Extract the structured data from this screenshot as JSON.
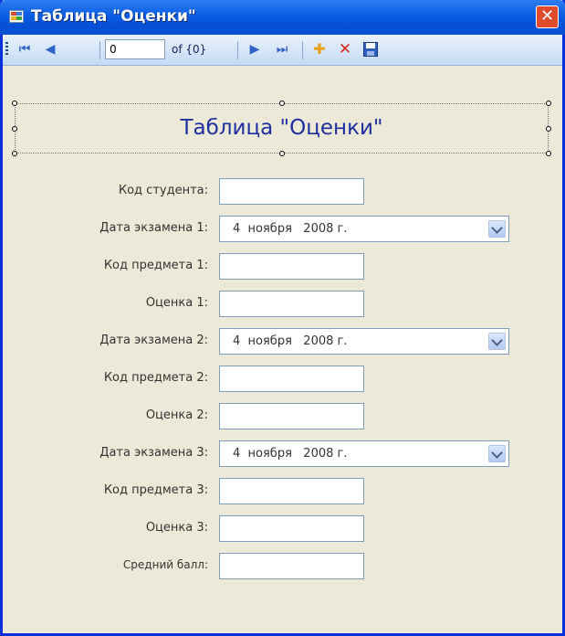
{
  "window": {
    "title": "Таблица \"Оценки\"",
    "close_glyph": "✕"
  },
  "toolbar": {
    "move_first": "⏮",
    "move_prev": "◀",
    "position_value": "0",
    "count_label": "of {0}",
    "move_next": "▶",
    "move_last": "⏭",
    "add_glyph": "✚",
    "delete_glyph": "✕",
    "save_glyph": "💾"
  },
  "form": {
    "header": "Таблица \"Оценки\"",
    "fields": [
      {
        "label": "Код студента:",
        "type": "text",
        "value": ""
      },
      {
        "label": "Дата экзамена 1:",
        "type": "date",
        "value": "4  ноября   2008 г."
      },
      {
        "label": "Код предмета 1:",
        "type": "text",
        "value": ""
      },
      {
        "label": "Оценка 1:",
        "type": "text",
        "value": ""
      },
      {
        "label": "Дата экзамена 2:",
        "type": "date",
        "value": "4  ноября   2008 г."
      },
      {
        "label": "Код предмета 2:",
        "type": "text",
        "value": ""
      },
      {
        "label": "Оценка 2:",
        "type": "text",
        "value": ""
      },
      {
        "label": "Дата экзамена 3:",
        "type": "date",
        "value": "4  ноября   2008 г."
      },
      {
        "label": "Код предмета 3:",
        "type": "text",
        "value": ""
      },
      {
        "label": "Оценка 3:",
        "type": "text",
        "value": ""
      },
      {
        "label": "Средний балл:",
        "type": "text",
        "value": ""
      }
    ]
  },
  "colors": {
    "titlebar": "#0a5ee3",
    "client_bg": "#ece9d8",
    "header_text": "#1e2f9e"
  }
}
